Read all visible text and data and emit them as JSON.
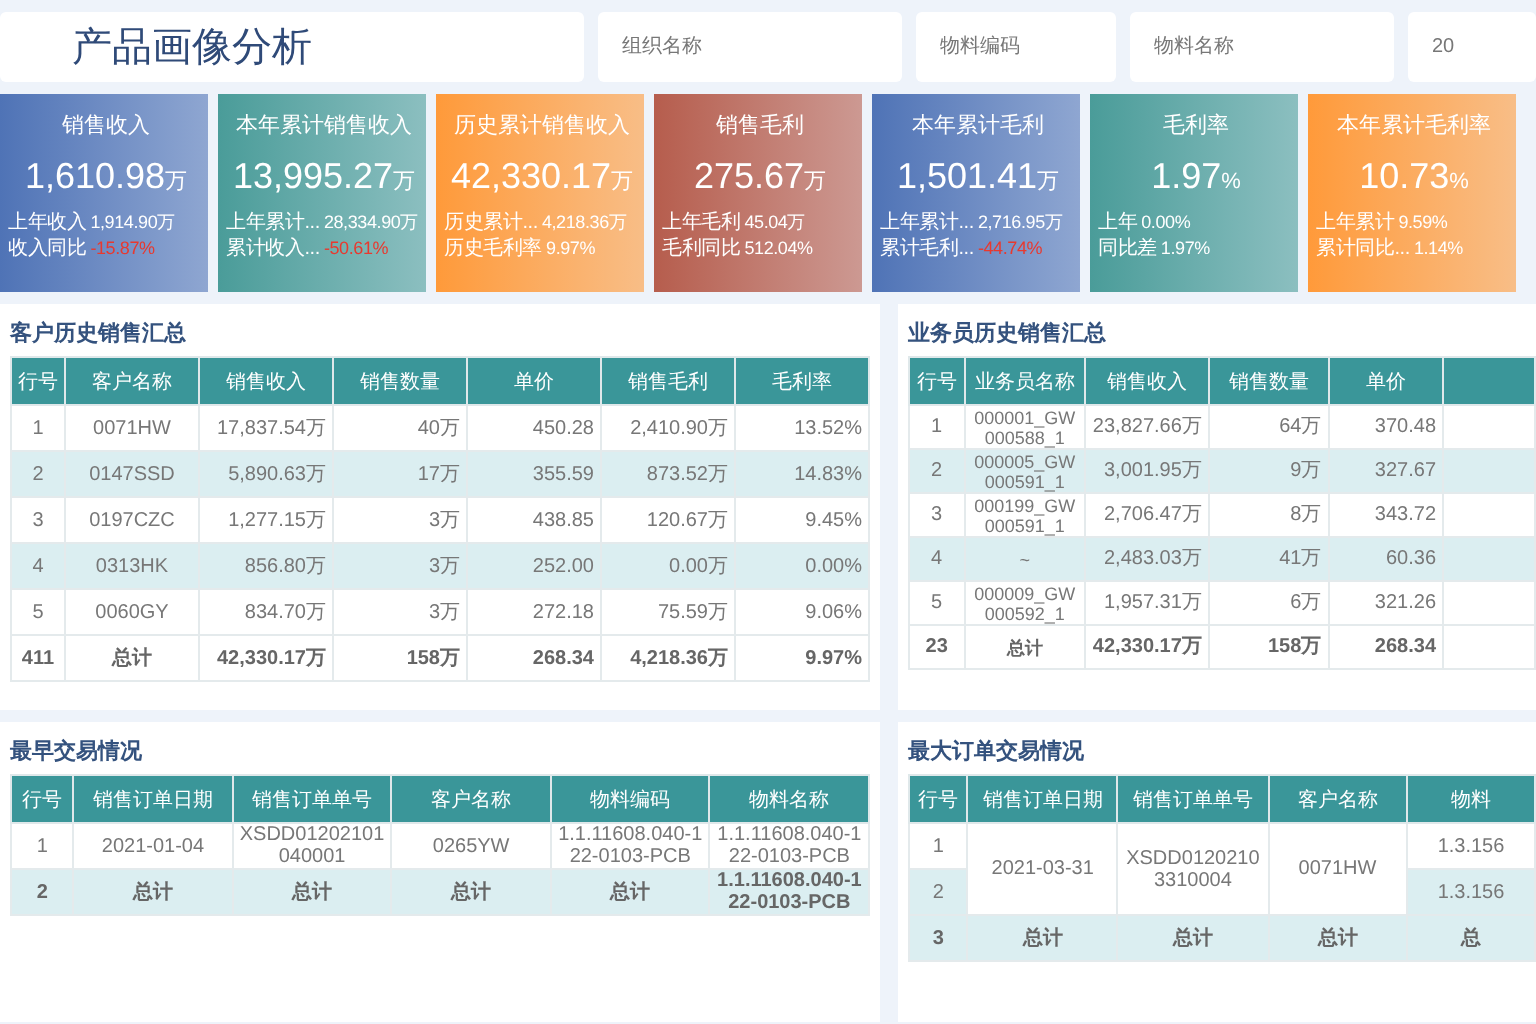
{
  "header": {
    "title": "产品画像分析"
  },
  "filters": [
    {
      "placeholder": "组织名称"
    },
    {
      "placeholder": "物料编码"
    },
    {
      "placeholder": "物料名称"
    },
    {
      "placeholder": "20"
    }
  ],
  "kpi_cards": [
    {
      "title": "销售收入",
      "value": "1,610.98",
      "unit": "万",
      "color": "#4f73b6",
      "rows": [
        {
          "label": "上年收入",
          "value": "1,914.90万",
          "negative": false
        },
        {
          "label": "收入同比",
          "value": "-15.87%",
          "negative": true
        }
      ]
    },
    {
      "title": "本年累计销售收入",
      "value": "13,995.27",
      "unit": "万",
      "color": "#4a9c99",
      "rows": [
        {
          "label": "上年累计...",
          "value": "28,334.90万",
          "negative": false
        },
        {
          "label": "累计收入...",
          "value": "-50.61%",
          "negative": true
        }
      ]
    },
    {
      "title": "历史累计销售收入",
      "value": "42,330.17",
      "unit": "万",
      "color": "#ff9a3a",
      "rows": [
        {
          "label": "历史累计...",
          "value": "4,218.36万",
          "negative": false
        },
        {
          "label": "历史毛利率",
          "value": "9.97%",
          "negative": false
        }
      ]
    },
    {
      "title": "销售毛利",
      "value": "275.67",
      "unit": "万",
      "color": "#b65d4d",
      "rows": [
        {
          "label": "上年毛利",
          "value": "45.04万",
          "negative": false
        },
        {
          "label": "毛利同比",
          "value": "512.04%",
          "negative": false
        }
      ]
    },
    {
      "title": "本年累计毛利",
      "value": "1,501.41",
      "unit": "万",
      "color": "#4f73b6",
      "rows": [
        {
          "label": "上年累计...",
          "value": "2,716.95万",
          "negative": false
        },
        {
          "label": "累计毛利...",
          "value": "-44.74%",
          "negative": true
        }
      ]
    },
    {
      "title": "毛利率",
      "value": "1.97",
      "unit": "%",
      "color": "#4a9c99",
      "rows": [
        {
          "label": "上年",
          "value": "0.00%",
          "negative": false
        },
        {
          "label": "同比差",
          "value": "1.97%",
          "negative": false
        }
      ]
    },
    {
      "title": "本年累计毛利率",
      "value": "10.73",
      "unit": "%",
      "color": "#ff9a3a",
      "rows": [
        {
          "label": "上年累计",
          "value": "9.59%",
          "negative": false
        },
        {
          "label": "累计同比...",
          "value": "1.14%",
          "negative": false
        }
      ]
    }
  ],
  "customer_summary": {
    "title": "客户历史销售汇总",
    "columns": [
      {
        "label": "行号",
        "kind": "index"
      },
      {
        "label": "客户名称",
        "kind": "text"
      },
      {
        "label": "销售收入",
        "kind": "number"
      },
      {
        "label": "销售数量",
        "kind": "number"
      },
      {
        "label": "单价",
        "kind": "number"
      },
      {
        "label": "销售毛利",
        "kind": "number"
      },
      {
        "label": "毛利率",
        "kind": "number"
      }
    ],
    "rows": [
      [
        "1",
        "0071HW",
        "17,837.54万",
        "40万",
        "450.28",
        "2,410.90万",
        "13.52%"
      ],
      [
        "2",
        "0147SSD",
        "5,890.63万",
        "17万",
        "355.59",
        "873.52万",
        "14.83%"
      ],
      [
        "3",
        "0197CZC",
        "1,277.15万",
        "3万",
        "438.85",
        "120.67万",
        "9.45%"
      ],
      [
        "4",
        "0313HK",
        "856.80万",
        "3万",
        "252.00",
        "0.00万",
        "0.00%"
      ],
      [
        "5",
        "0060GY",
        "834.70万",
        "3万",
        "272.18",
        "75.59万",
        "9.06%"
      ]
    ],
    "total": [
      "411",
      "总计",
      "42,330.17万",
      "158万",
      "268.34",
      "4,218.36万",
      "9.97%"
    ]
  },
  "salesperson_summary": {
    "title": "业务员历史销售汇总",
    "columns": [
      {
        "label": "行号",
        "kind": "index"
      },
      {
        "label": "业务员名称",
        "kind": "text"
      },
      {
        "label": "销售收入",
        "kind": "number"
      },
      {
        "label": "销售数量",
        "kind": "number"
      },
      {
        "label": "单价",
        "kind": "number"
      }
    ],
    "rows": [
      [
        "1",
        "000001_GW000588_1",
        "23,827.66万",
        "64万",
        "370.48"
      ],
      [
        "2",
        "000005_GW000591_1",
        "3,001.95万",
        "9万",
        "327.67"
      ],
      [
        "3",
        "000199_GW000591_1",
        "2,706.47万",
        "8万",
        "343.72"
      ],
      [
        "4",
        "~",
        "2,483.03万",
        "41万",
        "60.36"
      ],
      [
        "5",
        "000009_GW000592_1",
        "1,957.31万",
        "6万",
        "321.26"
      ]
    ],
    "total": [
      "23",
      "总计",
      "42,330.17万",
      "158万",
      "268.34"
    ]
  },
  "earliest_transactions": {
    "title": "最早交易情况",
    "columns": [
      {
        "label": "行号",
        "kind": "index"
      },
      {
        "label": "销售订单日期",
        "kind": "text"
      },
      {
        "label": "销售订单单号",
        "kind": "text"
      },
      {
        "label": "客户名称",
        "kind": "text"
      },
      {
        "label": "物料编码",
        "kind": "text"
      },
      {
        "label": "物料名称",
        "kind": "text"
      }
    ],
    "rows": [
      {
        "total": false,
        "cells": [
          {
            "text": "1"
          },
          {
            "text": "2021-01-04"
          },
          {
            "text": "XSDD01202101040001"
          },
          {
            "text": "0265YW"
          },
          {
            "text": "1.1.11608.040-122-0103-PCB"
          },
          {
            "text": "1.1.11608.040-122-0103-PCB"
          }
        ]
      },
      {
        "total": true,
        "cells": [
          {
            "text": "2"
          },
          {
            "text": "总计"
          },
          {
            "text": "总计"
          },
          {
            "text": "总计"
          },
          {
            "text": "总计"
          },
          {
            "text": "1.1.11608.040-122-0103-PCB"
          }
        ]
      }
    ]
  },
  "largest_order_transactions": {
    "title": "最大订单交易情况",
    "columns": [
      {
        "label": "行号",
        "kind": "index"
      },
      {
        "label": "销售订单日期",
        "kind": "text"
      },
      {
        "label": "销售订单单号",
        "kind": "text"
      },
      {
        "label": "客户名称",
        "kind": "text"
      },
      {
        "label": "物料",
        "kind": "text"
      }
    ],
    "rows": [
      {
        "total": false,
        "cells": [
          {
            "text": "1"
          },
          {
            "text": "2021-03-31",
            "rowspan": 2
          },
          {
            "text": "XSDD01202103310004",
            "rowspan": 2
          },
          {
            "text": "0071HW",
            "rowspan": 2
          },
          {
            "text": "1.3.156"
          }
        ]
      },
      {
        "total": false,
        "cells": [
          {
            "text": "2"
          },
          {
            "text": "1.3.156"
          }
        ]
      },
      {
        "total": true,
        "cells": [
          {
            "text": "3"
          },
          {
            "text": "总计"
          },
          {
            "text": "总计"
          },
          {
            "text": "总计"
          },
          {
            "text": "总"
          }
        ]
      }
    ]
  }
}
